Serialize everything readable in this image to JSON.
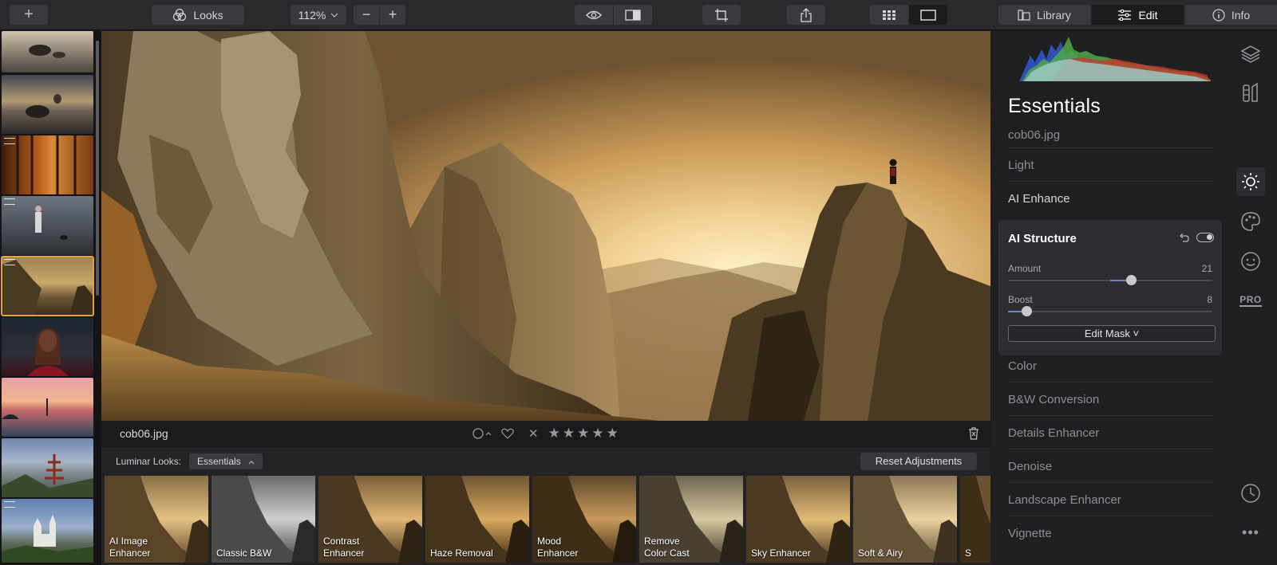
{
  "toolbar": {
    "add_label": "+",
    "looks_label": "Looks",
    "zoom_value": "112%",
    "zoom_out": "−",
    "zoom_in": "+",
    "tabs": [
      {
        "label": "Library",
        "icon": "library-icon"
      },
      {
        "label": "Edit",
        "icon": "sliders-icon"
      },
      {
        "label": "Info",
        "icon": "info-icon"
      }
    ],
    "active_tab": "Edit"
  },
  "filmstrip": {
    "thumbnails": [
      {
        "name": "beach-rocks-1",
        "selected": false
      },
      {
        "name": "beach-rocks-2",
        "selected": false
      },
      {
        "name": "autumn-forest",
        "selected": false
      },
      {
        "name": "street-runner",
        "selected": false
      },
      {
        "name": "cob06",
        "selected": true
      },
      {
        "name": "portrait-woman",
        "selected": false
      },
      {
        "name": "pink-sunset-lake",
        "selected": false
      },
      {
        "name": "pagoda-mountain",
        "selected": false
      },
      {
        "name": "castle",
        "selected": false
      }
    ]
  },
  "infobar": {
    "filename": "cob06.jpg",
    "stars": [
      "★",
      "★",
      "★",
      "★",
      "★"
    ],
    "reject": "✕"
  },
  "looks": {
    "label": "Luminar Looks:",
    "collection": "Essentials",
    "reset_label": "Reset Adjustments",
    "items": [
      {
        "caption": "AI Image\nEnhancer"
      },
      {
        "caption": "Classic B&W"
      },
      {
        "caption": "Contrast\nEnhancer"
      },
      {
        "caption": "Haze Removal"
      },
      {
        "caption": "Mood\nEnhancer"
      },
      {
        "caption": "Remove\nColor Cast"
      },
      {
        "caption": "Sky Enhancer"
      },
      {
        "caption": "Soft & Airy"
      },
      {
        "caption": "S"
      }
    ]
  },
  "panel": {
    "title": "Essentials",
    "filename": "cob06.jpg",
    "items_top": [
      "Light",
      "AI Enhance"
    ],
    "card": {
      "title": "AI Structure",
      "sliders": [
        {
          "label": "Amount",
          "value": "21",
          "fraction": 0.6
        },
        {
          "label": "Boost",
          "value": "8",
          "fraction": 0.09
        }
      ],
      "mask_label": "Edit Mask ˅"
    },
    "items_bottom": [
      "Color",
      "B&W Conversion",
      "Details Enhancer",
      "Denoise",
      "Landscape Enhancer",
      "Vignette"
    ]
  },
  "rail": {
    "icons": [
      "layers-icon",
      "presets-icon",
      "sun-icon",
      "palette-icon",
      "face-icon",
      "pro-icon",
      "history-icon",
      "more-icon"
    ],
    "pro_label": "PRO",
    "more_label": "•••"
  },
  "colors": {
    "accent_selection": "#e0a33a",
    "slider_fill": "#6d84c8",
    "panel_bg": "#1f1f21",
    "toolbar_bg": "#2a2a2d"
  }
}
